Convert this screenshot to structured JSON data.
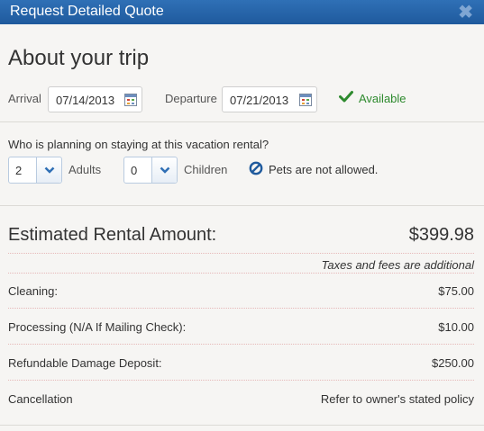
{
  "dialog": {
    "title": "Request Detailed Quote",
    "close_glyph": "✖"
  },
  "trip": {
    "heading": "About your trip",
    "arrival_label": "Arrival",
    "arrival_value": "07/14/2013",
    "departure_label": "Departure",
    "departure_value": "07/21/2013",
    "availability": "Available"
  },
  "guests": {
    "question": "Who is planning on staying at this vacation rental?",
    "adults_value": "2",
    "adults_label": "Adults",
    "children_value": "0",
    "children_label": "Children",
    "pets_note": "Pets are not allowed."
  },
  "estimate": {
    "label": "Estimated Rental Amount:",
    "amount": "$399.98",
    "tax_note": "Taxes and fees are additional",
    "fees": [
      {
        "name": "Cleaning:",
        "amount": "$75.00"
      },
      {
        "name": "Processing (N/A If Mailing Check):",
        "amount": "$10.00"
      },
      {
        "name": "Refundable Damage Deposit:",
        "amount": "$250.00"
      },
      {
        "name": "Cancellation",
        "amount": "Refer to owner's stated policy"
      }
    ]
  },
  "colors": {
    "titlebar": "#2f70b6",
    "available": "#2e8a2e",
    "no_pets_icon": "#1f5a9d"
  }
}
